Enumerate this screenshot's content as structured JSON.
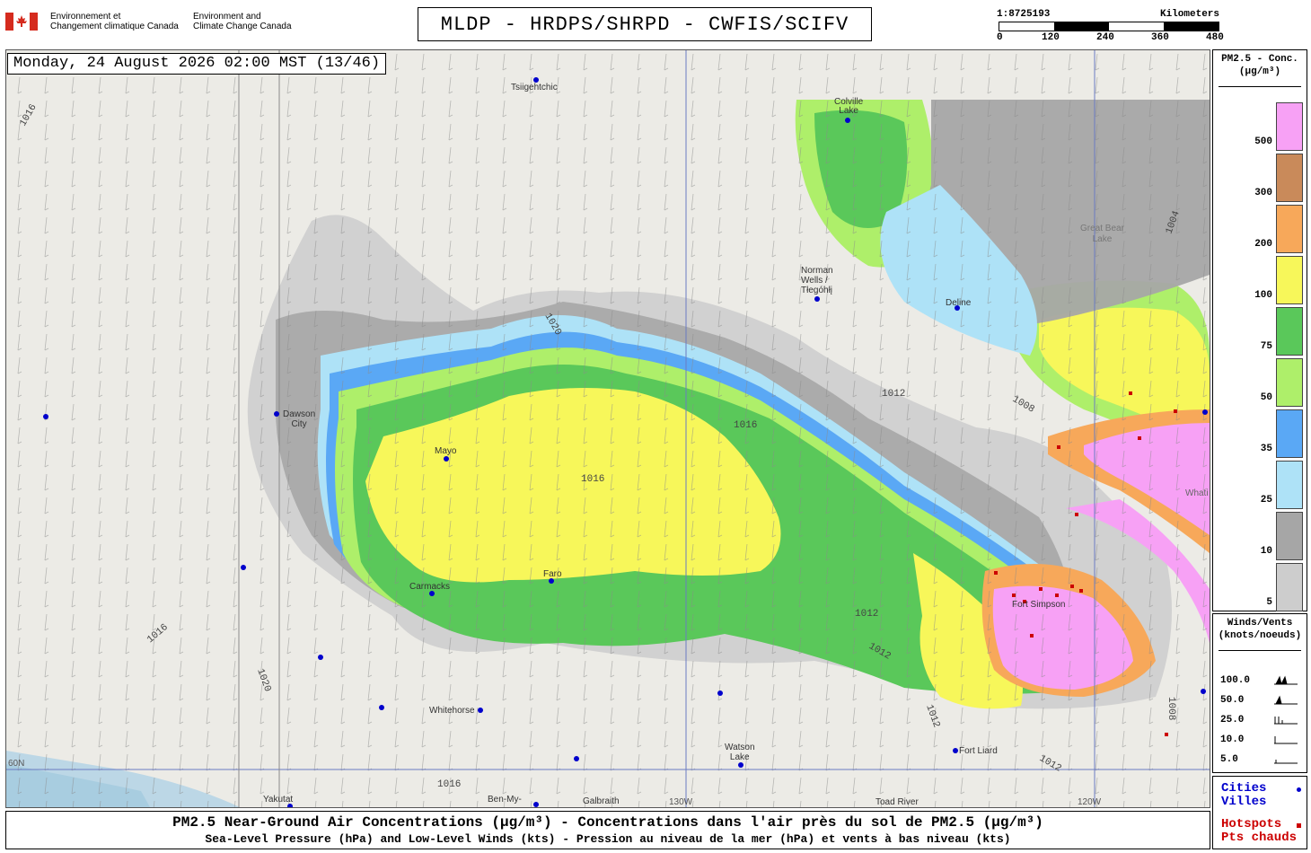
{
  "header": {
    "org_fr": "Environnement et\nChangement climatique Canada",
    "org_en": "Environment and\nClimate Change Canada",
    "title": "MLDP - HRDPS/SHRPD - CWFIS/SCIFV",
    "scale_ratio": "1:8725193",
    "scale_unit": "Kilometers",
    "scale_ticks": [
      "0",
      "120",
      "240",
      "360",
      "480"
    ]
  },
  "map": {
    "datetime": "Monday, 24 August 2026 02:00 MST (13/46)",
    "places": [
      {
        "name": "Tsiigehtchic"
      },
      {
        "name": "Colville\nLake"
      },
      {
        "name": "Norman\nWells /\nTłegóhłį"
      },
      {
        "name": "Deline"
      },
      {
        "name": "Dawson\nCity"
      },
      {
        "name": "Mayo"
      },
      {
        "name": "Carmacks"
      },
      {
        "name": "Faro"
      },
      {
        "name": "Whitehorse"
      },
      {
        "name": "Watson\nLake"
      },
      {
        "name": "Fort Liard"
      },
      {
        "name": "Fort Simpson"
      },
      {
        "name": "Yakutat"
      },
      {
        "name": "Ben-My-"
      },
      {
        "name": "Galbraith"
      },
      {
        "name": "Toad River"
      },
      {
        "name": "Great Bear\nLake"
      },
      {
        "name": "Whati"
      }
    ],
    "isobar_labels": [
      "1016",
      "1020",
      "1012",
      "1008",
      "1004"
    ],
    "grid_labels": [
      "60N",
      "130W",
      "120W"
    ]
  },
  "legend": {
    "pm_title": "PM2.5 - Conc.\n(µg/m³)",
    "pm_bins": [
      {
        "label": "500",
        "color": "#f7a1f5"
      },
      {
        "label": "300",
        "color": "#c98a5a"
      },
      {
        "label": "200",
        "color": "#f7a85a"
      },
      {
        "label": "100",
        "color": "#f7f75a"
      },
      {
        "label": "75",
        "color": "#5ac85a"
      },
      {
        "label": "50",
        "color": "#aeef6a"
      },
      {
        "label": "35",
        "color": "#5aa8f5"
      },
      {
        "label": "25",
        "color": "#aee2f7"
      },
      {
        "label": "10",
        "color": "#a6a6a6"
      },
      {
        "label": "5",
        "color": "#cdcdcd"
      }
    ],
    "wind_title": "Winds/Vents\n(knots/noeuds)",
    "wind_rows": [
      "100.0",
      "50.0",
      "25.0",
      "10.0",
      "5.0"
    ],
    "cities_en": "Cities",
    "cities_fr": "Villes",
    "hotspots_en": "Hotspots",
    "hotspots_fr": "Pts chauds",
    "cities_color": "#0000cc",
    "hotspots_color": "#cc0000"
  },
  "footer": {
    "line1": "PM2.5 Near-Ground Air Concentrations (µg/m³) - Concentrations dans l'air près du sol de PM2.5 (µg/m³)",
    "line2": "Sea-Level Pressure (hPa) and Low-Level Winds (kts) - Pression au niveau de la mer (hPa) et vents à bas niveau (kts)"
  }
}
